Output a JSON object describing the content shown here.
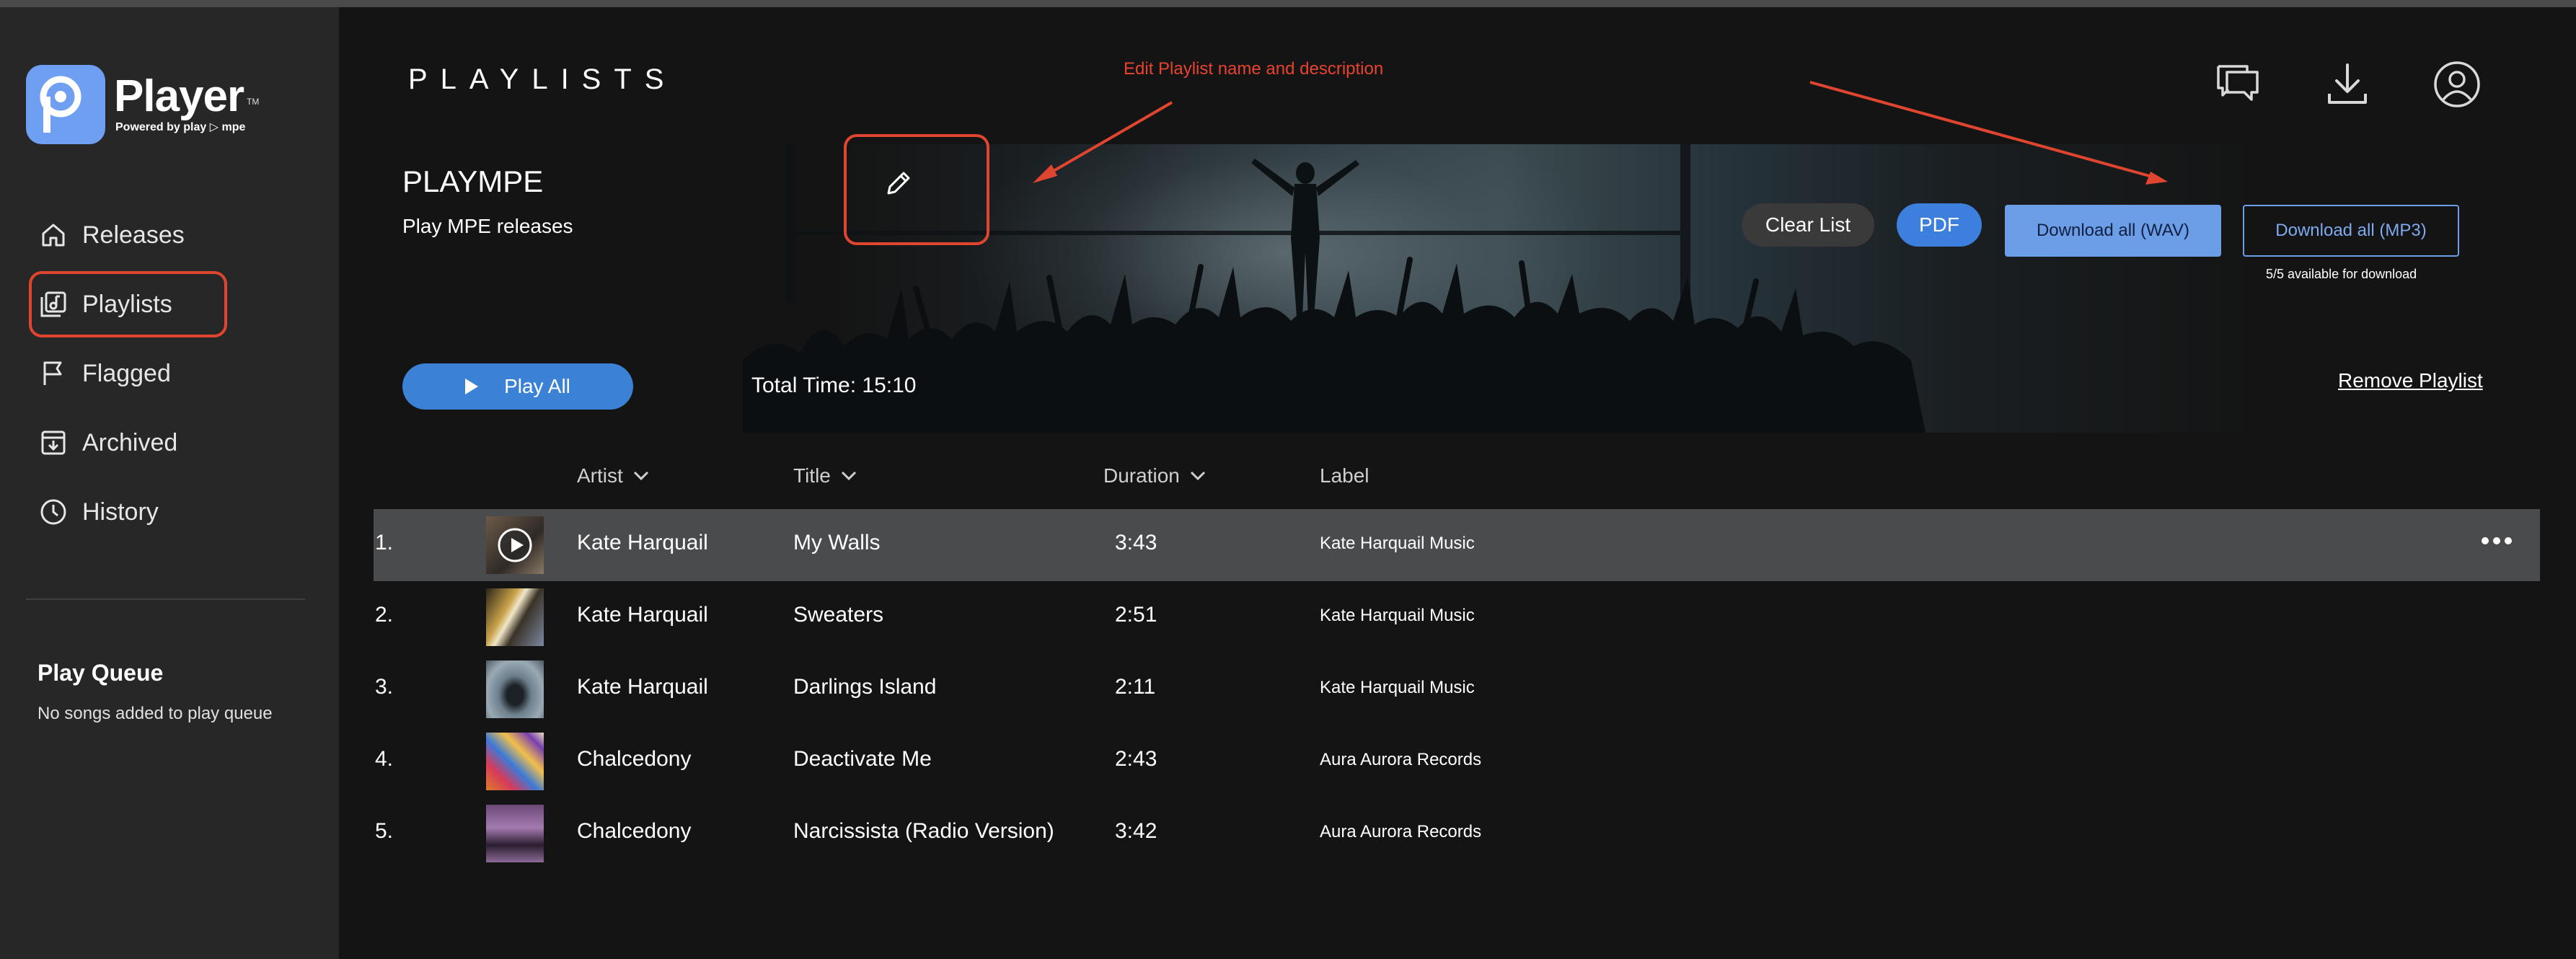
{
  "app": {
    "name": "Player",
    "tm": "TM",
    "powered_by": "Powered by play ▷ mpe"
  },
  "sidebar": {
    "items": [
      {
        "label": "Releases",
        "icon": "home-icon",
        "active": false
      },
      {
        "label": "Playlists",
        "icon": "playlist-icon",
        "active": true
      },
      {
        "label": "Flagged",
        "icon": "flag-icon",
        "active": false
      },
      {
        "label": "Archived",
        "icon": "archive-icon",
        "active": false
      },
      {
        "label": "History",
        "icon": "clock-icon",
        "active": false
      }
    ],
    "queue_title": "Play Queue",
    "queue_empty": "No songs added to play queue"
  },
  "header": {
    "title": "PLAYLISTS",
    "icons": [
      "chat-icon",
      "download-icon",
      "user-icon"
    ]
  },
  "annotation": {
    "text": "Edit Playlist name and description",
    "color": "#e8432f"
  },
  "playlist": {
    "name": "PLAYMPE",
    "description": "Play MPE releases",
    "clear_label": "Clear List",
    "pdf_label": "PDF",
    "download_wav_label": "Download all (WAV)",
    "download_mp3_label": "Download all (MP3)",
    "availability": "5/5 available for download",
    "play_all_label": "Play All",
    "total_time": "Total Time: 15:10",
    "remove_label": "Remove Playlist"
  },
  "table": {
    "columns": {
      "artist": "Artist",
      "title": "Title",
      "duration": "Duration",
      "label": "Label"
    },
    "rows": [
      {
        "num": "1.",
        "artist": "Kate Harquail",
        "title": "My Walls",
        "duration": "3:43",
        "label": "Kate Harquail Music",
        "selected": true
      },
      {
        "num": "2.",
        "artist": "Kate Harquail",
        "title": "Sweaters",
        "duration": "2:51",
        "label": "Kate Harquail Music",
        "selected": false
      },
      {
        "num": "3.",
        "artist": "Kate Harquail",
        "title": "Darlings Island",
        "duration": "2:11",
        "label": "Kate Harquail Music",
        "selected": false
      },
      {
        "num": "4.",
        "artist": "Chalcedony",
        "title": "Deactivate Me",
        "duration": "2:43",
        "label": "Aura Aurora Records",
        "selected": false
      },
      {
        "num": "5.",
        "artist": "Chalcedony",
        "title": "Narcissista (Radio Version)",
        "duration": "3:42",
        "label": "Aura Aurora Records",
        "selected": false
      }
    ]
  },
  "colors": {
    "accent_blue": "#3b82d6",
    "download_blue": "#6c9ee7",
    "annotation_red": "#e0452f",
    "sidebar_bg": "#272727",
    "main_bg": "#141414"
  }
}
